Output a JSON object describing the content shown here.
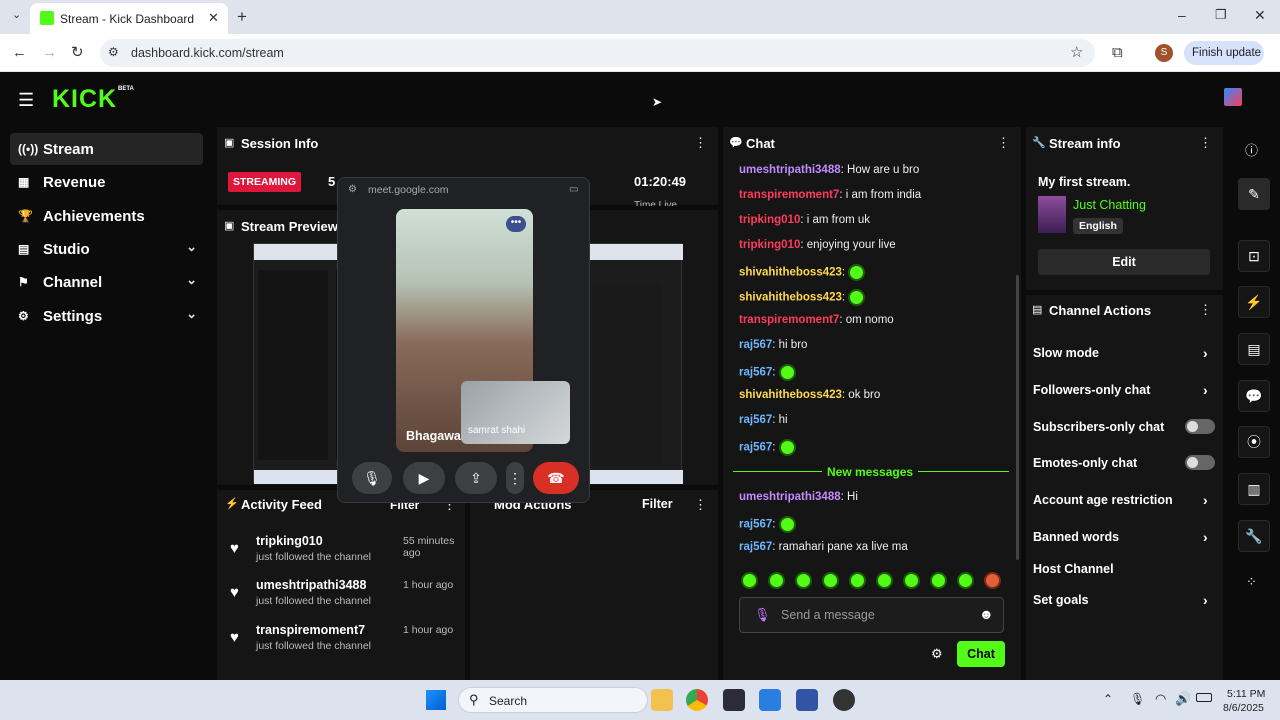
{
  "browser": {
    "tab_title": "Stream - Kick Dashboard",
    "url": "dashboard.kick.com/stream",
    "profile_letter": "S",
    "finish_update": "Finish update"
  },
  "brand": {
    "logo": "KICK",
    "beta": "BETA",
    "accent": "#53fc18"
  },
  "sidebar": {
    "items": [
      {
        "label": "Stream",
        "icon": "broadcast-icon"
      },
      {
        "label": "Revenue",
        "icon": "chart-icon"
      },
      {
        "label": "Achievements",
        "icon": "trophy-icon"
      },
      {
        "label": "Studio",
        "icon": "studio-icon"
      },
      {
        "label": "Channel",
        "icon": "channel-icon"
      },
      {
        "label": "Settings",
        "icon": "gear-icon"
      }
    ]
  },
  "session": {
    "title": "Session Info",
    "status": "STREAMING",
    "viewers": "5",
    "time": "01:20:49",
    "time_label": "Time Live"
  },
  "preview": {
    "title": "Stream Preview"
  },
  "meet": {
    "domain": "meet.google.com",
    "main_name": "Bhagawa",
    "pip_name": "samrat shahi"
  },
  "activity": {
    "title": "Activity Feed",
    "filter": "Filter",
    "items": [
      {
        "name": "tripking010",
        "time": "55 minutes ago",
        "sub": "just followed the channel"
      },
      {
        "name": "umeshtripathi3488",
        "time": "1 hour ago",
        "sub": "just followed the channel"
      },
      {
        "name": "transpiremoment7",
        "time": "1 hour ago",
        "sub": "just followed the channel"
      }
    ]
  },
  "mod": {
    "title": "Mod Actions",
    "filter": "Filter"
  },
  "chat": {
    "title": "Chat",
    "messages": [
      {
        "user": "umeshtripathi3488",
        "color": "#c08bff",
        "text": "How are u bro"
      },
      {
        "user": "transpiremoment7",
        "color": "#ff3b5c",
        "text": "i am from india"
      },
      {
        "user": "tripking010",
        "color": "#ff3b5c",
        "text": "i am from uk"
      },
      {
        "user": "tripking010",
        "color": "#ff3b5c",
        "text": "enjoying your live"
      },
      {
        "user": "shivahitheboss423",
        "color": "#ffd84d",
        "text": ""
      },
      {
        "user": "shivahitheboss423",
        "color": "#ffd84d",
        "text": ""
      },
      {
        "user": "transpiremoment7",
        "color": "#ff3b5c",
        "text": "om nomo"
      },
      {
        "user": "raj567",
        "color": "#6fb6ff",
        "text": "hi bro"
      },
      {
        "user": "raj567",
        "color": "#6fb6ff",
        "text": ""
      },
      {
        "user": "shivahitheboss423",
        "color": "#ffd84d",
        "text": "ok bro"
      },
      {
        "user": "raj567",
        "color": "#6fb6ff",
        "text": "hi"
      },
      {
        "user": "raj567",
        "color": "#6fb6ff",
        "text": ""
      }
    ],
    "new_messages": "New messages",
    "new": [
      {
        "user": "umeshtripathi3488",
        "color": "#c08bff",
        "text": "Hi"
      },
      {
        "user": "raj567",
        "color": "#6fb6ff",
        "text": ""
      },
      {
        "user": "raj567",
        "color": "#6fb6ff",
        "text": "ramahari pane xa live ma"
      }
    ],
    "placeholder": "Send a message",
    "send": "Chat"
  },
  "stream_info": {
    "title": "Stream info",
    "stream_title": "My first stream.",
    "category": "Just Chatting",
    "language": "English",
    "edit": "Edit"
  },
  "channel_actions": {
    "title": "Channel Actions",
    "items": [
      {
        "label": "Slow mode",
        "kind": "arrow"
      },
      {
        "label": "Followers-only chat",
        "kind": "arrow"
      },
      {
        "label": "Subscribers-only chat",
        "kind": "toggle"
      },
      {
        "label": "Emotes-only chat",
        "kind": "toggle"
      },
      {
        "label": "Account age restriction",
        "kind": "arrow"
      },
      {
        "label": "Banned words",
        "kind": "arrow"
      },
      {
        "label": "Host Channel",
        "kind": "none"
      },
      {
        "label": "Set goals",
        "kind": "arrow"
      }
    ]
  },
  "taskbar": {
    "search": "Search",
    "time": "5:11 PM",
    "date": "8/6/2025"
  }
}
